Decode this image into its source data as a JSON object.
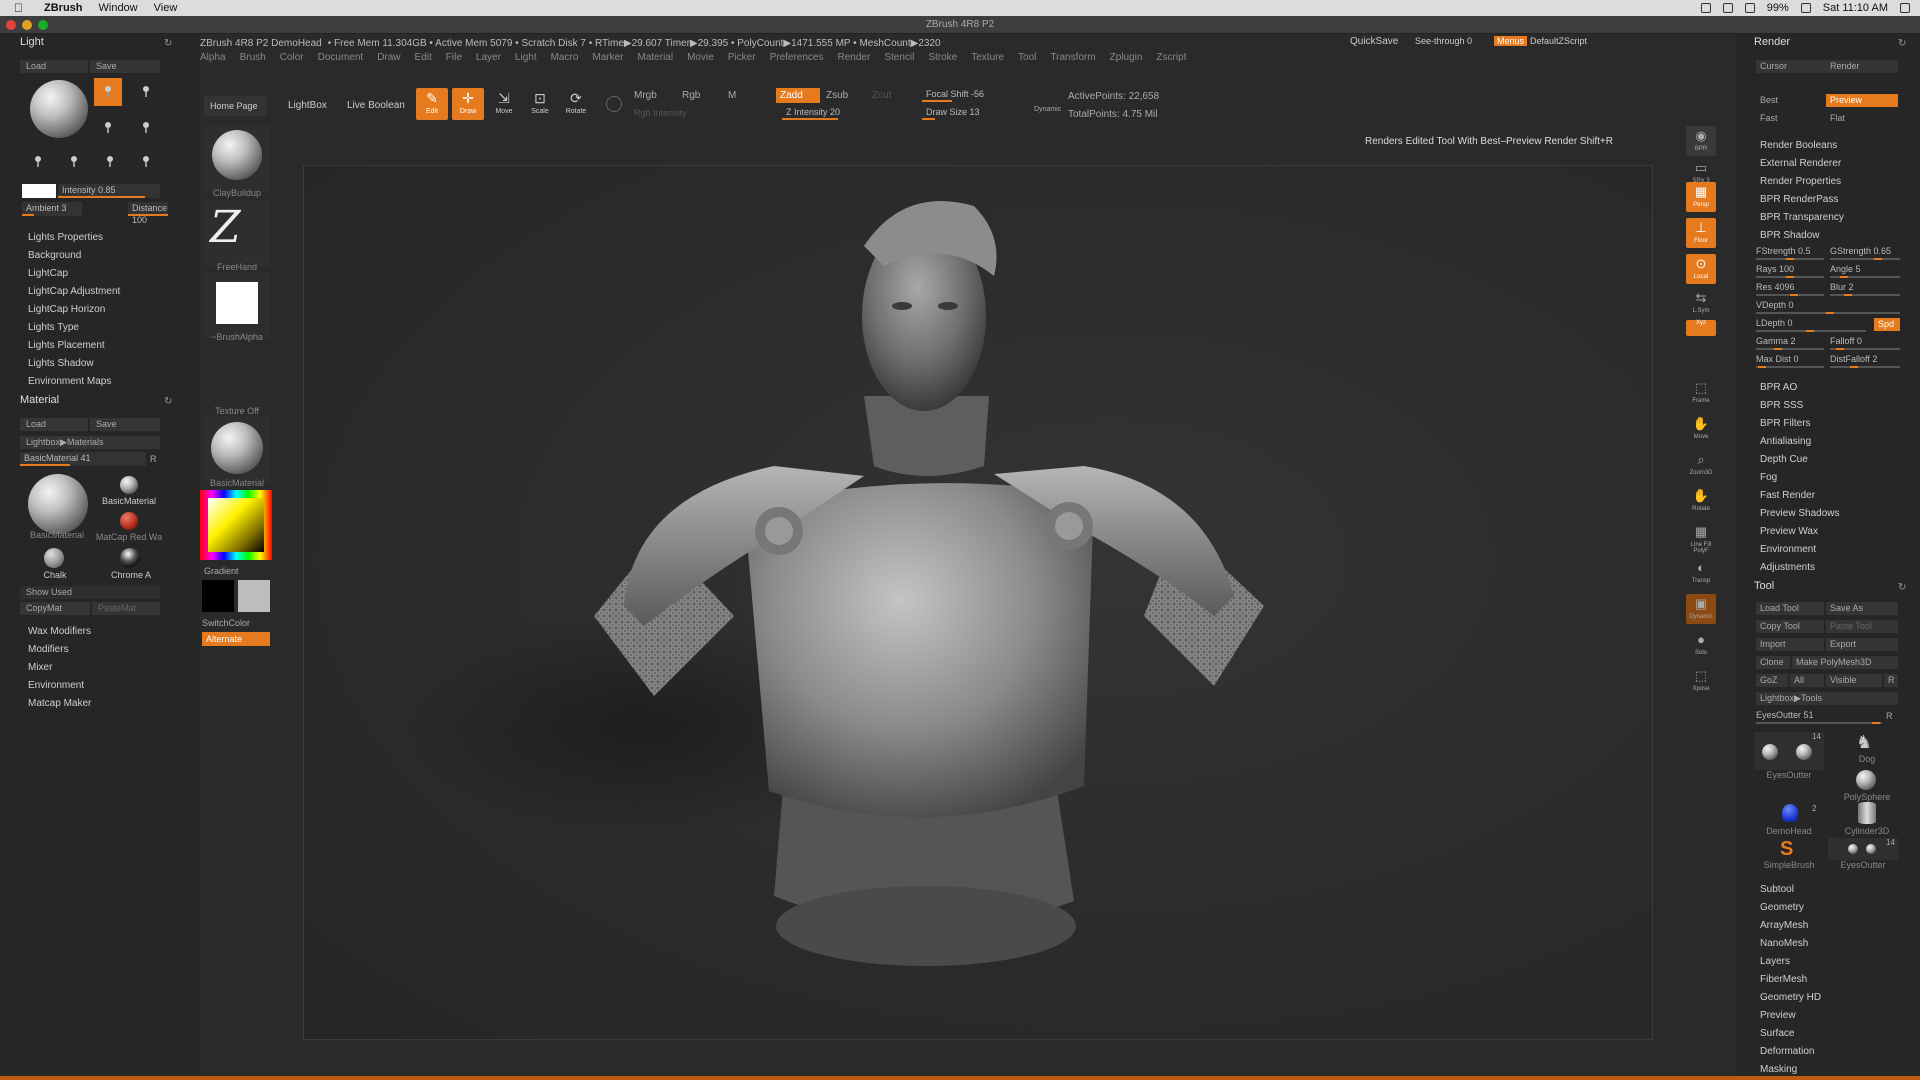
{
  "mac_menu": {
    "apple": "",
    "app_name": "ZBrush",
    "items": [
      "Window",
      "View"
    ],
    "status": [
      "99%",
      "Sat 11:10 AM"
    ]
  },
  "window": {
    "title": "ZBrush 4R8 P2"
  },
  "infobar": {
    "doc": "ZBrush 4R8 P2  DemoHead",
    "stats": "• Free Mem 11.304GB • Active Mem 5079 • Scratch Disk 7 •  RTime▶29.607 Timer▶29.395 • PolyCount▶1471.555 MP  • MeshCount▶2320",
    "quicksave": "QuickSave",
    "see_through": "See-through  0",
    "menus": "Menus",
    "default_zscript": "DefaultZScript"
  },
  "main_menu": [
    "Alpha",
    "Brush",
    "Color",
    "Document",
    "Draw",
    "Edit",
    "File",
    "Layer",
    "Light",
    "Macro",
    "Marker",
    "Material",
    "Movie",
    "Picker",
    "Preferences",
    "Render",
    "Stencil",
    "Stroke",
    "Texture",
    "Tool",
    "Transform",
    "Zplugin",
    "Zscript"
  ],
  "light_panel": {
    "title": "Light",
    "load": "Load",
    "save": "Save",
    "intensity": "Intensity 0.85",
    "ambient": "Ambient 3",
    "distance": "Distance 100",
    "items": [
      "Lights Properties",
      "Background",
      "LightCap",
      "LightCap Adjustment",
      "LightCap Horizon",
      "Lights Type",
      "Lights Placement",
      "Lights Shadow",
      "Environment Maps"
    ]
  },
  "material_panel": {
    "title": "Material",
    "load": "Load",
    "save": "Save",
    "lightbox": "Lightbox▶Materials",
    "slider": "BasicMaterial  41",
    "slider_r": "R",
    "thumbs": [
      "BasicMaterial",
      "BasicMaterial",
      "MatCap Red Wa",
      "Chalk",
      "Chrome A"
    ],
    "show_used": "Show Used",
    "copy_mat": "CopyMat",
    "paste_mat": "PasteMat",
    "items": [
      "Wax Modifiers",
      "Modifiers",
      "Mixer",
      "Environment",
      "Matcap Maker"
    ]
  },
  "col2": {
    "home_page": "Home Page",
    "brushes": [
      "ClayBuildup",
      "FreeHand",
      "~BrushAlpha",
      "Texture Off",
      "BasicMaterial"
    ],
    "gradient": "Gradient",
    "switch_color": "SwitchColor",
    "alternate": "Alternate"
  },
  "toolbar": {
    "lightbox": "LightBox",
    "live_boolean": "Live Boolean",
    "buttons": [
      "Edit",
      "Draw",
      "Move",
      "Scale",
      "Rotate"
    ],
    "mrgb": "Mrgb",
    "rgb": "Rgb",
    "m": "M",
    "rgb_intensity": "Rgb Intensity",
    "zadd": "Zadd",
    "zsub": "Zsub",
    "zcut": "Zcut",
    "z_intensity": "Z Intensity 20",
    "focal_shift": "Focal Shift  -56",
    "draw_size": "Draw Size  13",
    "dynamic": "Dynamic",
    "active_points": "ActivePoints: 22,658",
    "total_points": "TotalPoints: 4.75 Mil"
  },
  "tooltip": "Renders Edited Tool With Best–Preview Render  Shift+R",
  "shelf": {
    "buttons": [
      "BPR",
      "SPix 3",
      "Persp",
      "Floor",
      "Local",
      "L.Sym",
      "Xyz",
      "Frame",
      "Move",
      "Zoom3D",
      "Rotate",
      "Line Fill PolyF",
      "Transp",
      "Dynamic",
      "Solo",
      "Xpose"
    ]
  },
  "render_panel": {
    "title": "Render",
    "cursor": "Cursor",
    "render": "Render",
    "best": "Best",
    "preview": "Preview",
    "fast": "Fast",
    "flat": "Flat",
    "items_top": [
      "Render Booleans",
      "External Renderer",
      "Render Properties",
      "BPR RenderPass",
      "BPR Transparency",
      "BPR Shadow"
    ],
    "fstrength": "FStrength 0.5",
    "gstrength": "GStrength 0.65",
    "rays": "Rays 100",
    "angle": "Angle 5",
    "res": "Res 4096",
    "blur": "Blur 2",
    "vdepth": "VDepth 0",
    "ldepth": "LDepth 0",
    "spd": "Spd",
    "gamma": "Gamma 2",
    "falloff": "Falloff 0",
    "maxdist": "Max Dist 0",
    "distfalloff": "DistFalloff 2",
    "items_bottom": [
      "BPR AO",
      "BPR SSS",
      "BPR Filters",
      "Antialiasing",
      "Depth Cue",
      "Fog",
      "Fast Render",
      "Preview Shadows",
      "Preview Wax",
      "Environment",
      "Adjustments"
    ]
  },
  "tool_panel": {
    "title": "Tool",
    "load_tool": "Load Tool",
    "save_as": "Save As",
    "copy_tool": "Copy Tool",
    "paste_tool": "Paste Tool",
    "import": "Import",
    "export": "Export",
    "clone": "Clone",
    "make_polymesh": "Make PolyMesh3D",
    "goz": "GoZ",
    "all": "All",
    "visible": "Visible",
    "r": "R",
    "lightbox": "Lightbox▶Tools",
    "slider": "EyesOutter  51",
    "thumbs": [
      {
        "label": "EyesOutter",
        "count": "14"
      },
      {
        "label": "Dog",
        "count": ""
      },
      {
        "label": "PolySphere",
        "count": ""
      },
      {
        "label": "DemoHead",
        "count": "2"
      },
      {
        "label": "Cylinder3D",
        "count": ""
      },
      {
        "label": "SimpleBrush",
        "count": ""
      },
      {
        "label": "EyesOutter",
        "count": "14"
      }
    ],
    "items": [
      "Subtool",
      "Geometry",
      "ArrayMesh",
      "NanoMesh",
      "Layers",
      "FiberMesh",
      "Geometry HD",
      "Preview",
      "Surface",
      "Deformation",
      "Masking"
    ]
  },
  "colors": {
    "accent": "#e57a1e",
    "panel": "#262626",
    "canvas": "#2b2b2b"
  }
}
